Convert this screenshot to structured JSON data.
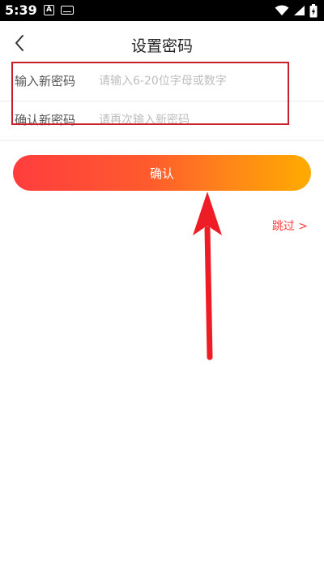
{
  "status_bar": {
    "time": "5:39",
    "notification_letter": "A",
    "icons": [
      "notification-a-icon",
      "keyboard-icon",
      "wifi-icon",
      "signal-icon",
      "battery-icon"
    ]
  },
  "header": {
    "title": "设置密码",
    "back_icon": "chevron-left-icon"
  },
  "form": {
    "new_password": {
      "label": "输入新密码",
      "value": "",
      "placeholder": "请输入6-20位字母或数字"
    },
    "confirm_password": {
      "label": "确认新密码",
      "value": "",
      "placeholder": "请再次输入新密码"
    }
  },
  "confirm_button": {
    "label": "确认"
  },
  "skip": {
    "label": "跳过 >"
  },
  "colors": {
    "accent": "#ff3d3d",
    "gradient_start": "#ff3d3d",
    "gradient_end": "#ffab00",
    "annotation": "#d0202a"
  }
}
